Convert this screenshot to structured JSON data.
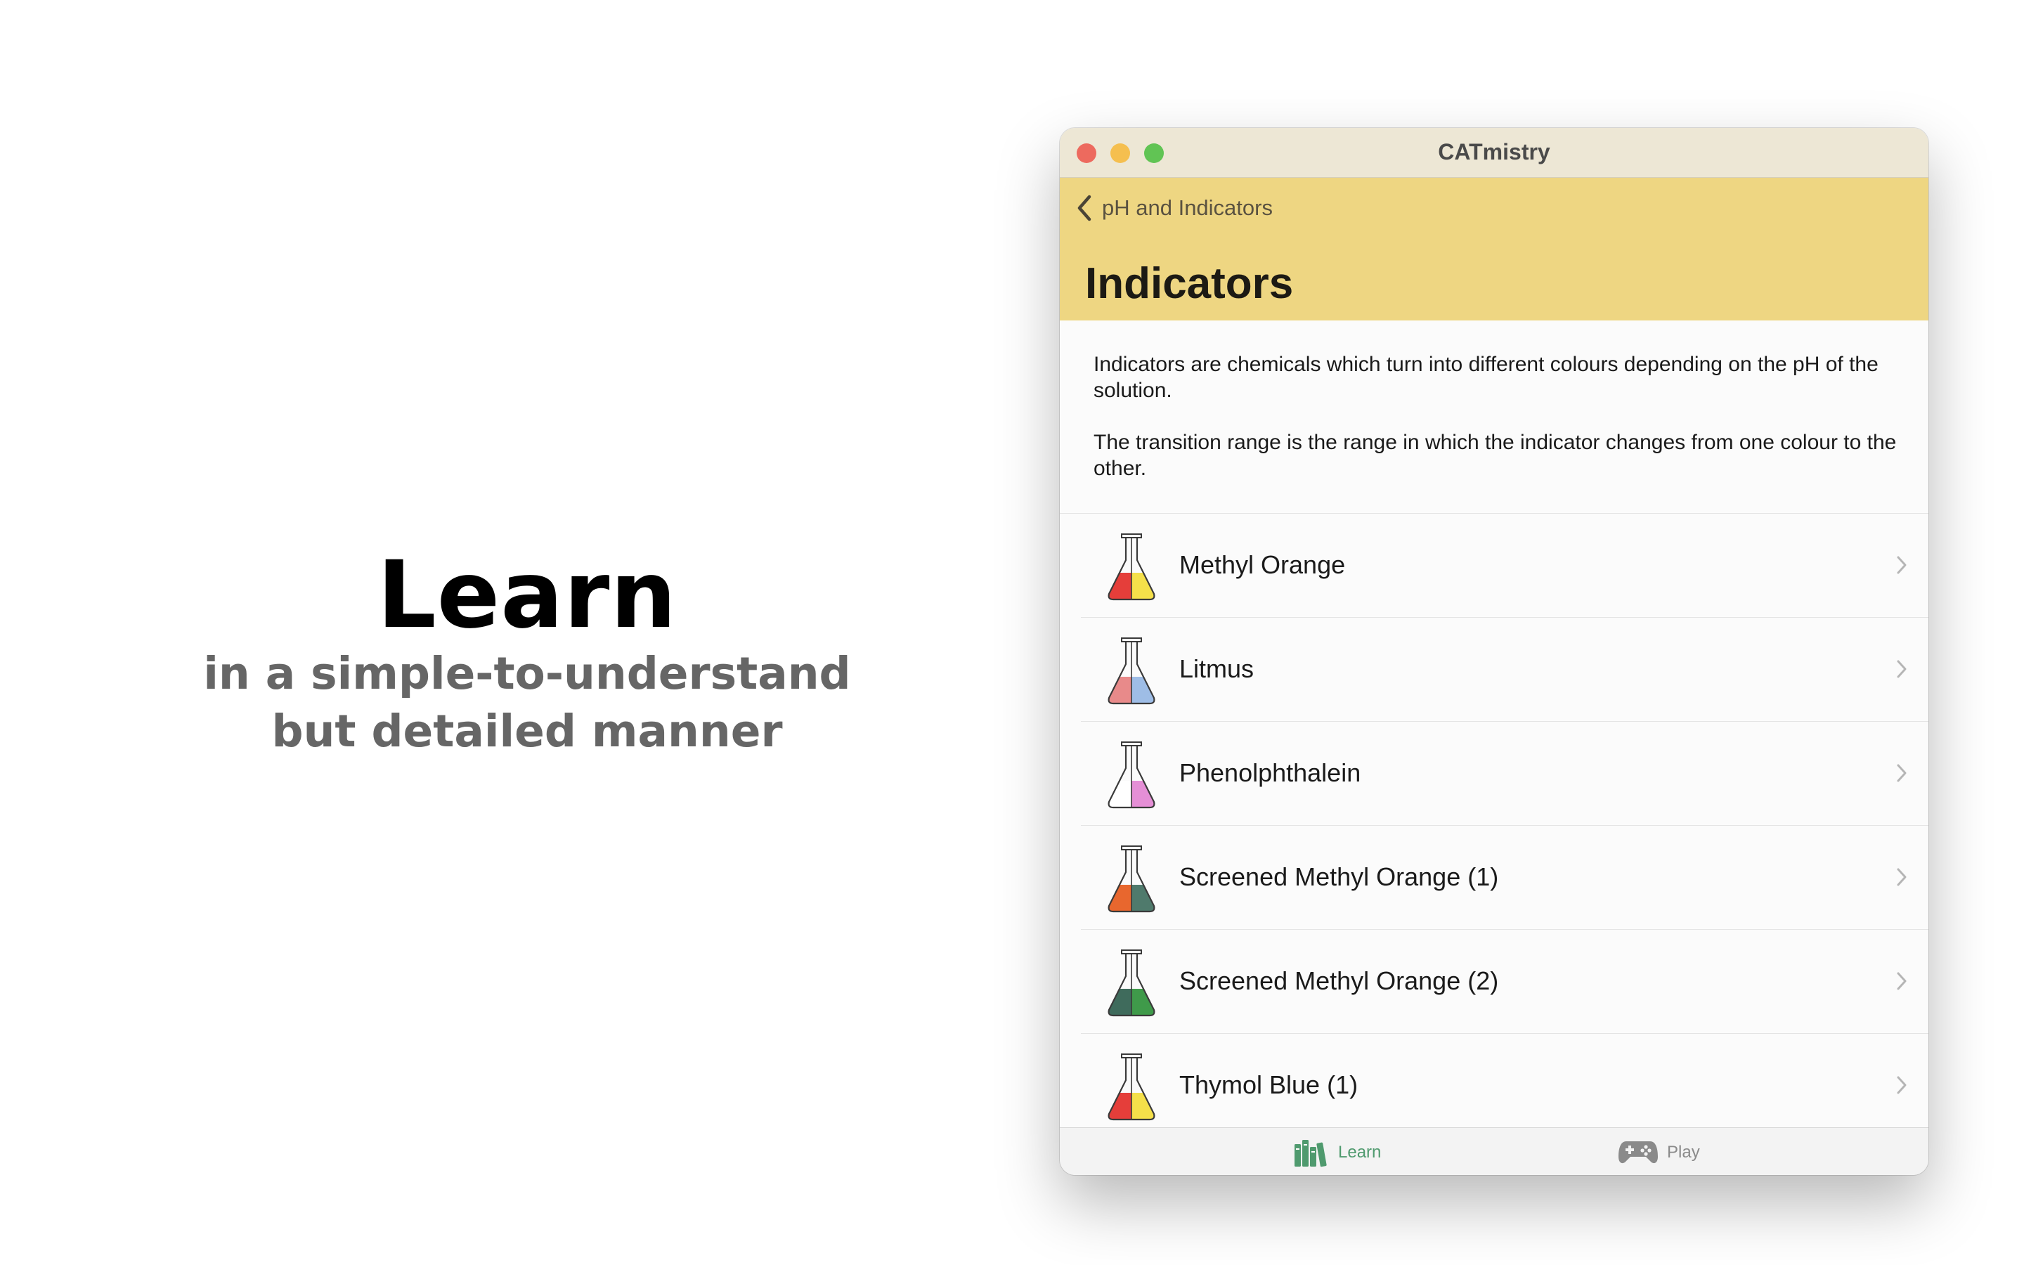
{
  "promo": {
    "title": "Learn",
    "subtitle_line1": "in a simple-to-understand",
    "subtitle_line2": "but detailed manner"
  },
  "window": {
    "title": "CATmistry",
    "back_label": "pH and Indicators",
    "page_title": "Indicators"
  },
  "description": {
    "paragraph1": "Indicators are chemicals which turn into different colours depending on the pH of the solution.",
    "paragraph2": "The transition range is the range in which the indicator changes from one colour to the other."
  },
  "indicators": [
    {
      "label": "Methyl Orange",
      "acid_color": "#e53e3a",
      "alkali_color": "#f5e04a"
    },
    {
      "label": "Litmus",
      "acid_color": "#e88a8a",
      "alkali_color": "#9ebde6"
    },
    {
      "label": "Phenolphthalein",
      "acid_color": "#ffffff",
      "alkali_color": "#e58fd6"
    },
    {
      "label": "Screened Methyl Orange (1)",
      "acid_color": "#e8672e",
      "alkali_color": "#4f7a6c"
    },
    {
      "label": "Screened Methyl Orange (2)",
      "acid_color": "#3f6b5c",
      "alkali_color": "#3f9a4a"
    },
    {
      "label": "Thymol Blue (1)",
      "acid_color": "#e53e3a",
      "alkali_color": "#f5e04a"
    }
  ],
  "tabs": {
    "learn_label": "Learn",
    "play_label": "Play",
    "active_color": "#4f9a6e",
    "inactive_color": "#8a8a8a"
  },
  "colors": {
    "navbar": "#eed682",
    "titlebar": "#ede7d5"
  }
}
